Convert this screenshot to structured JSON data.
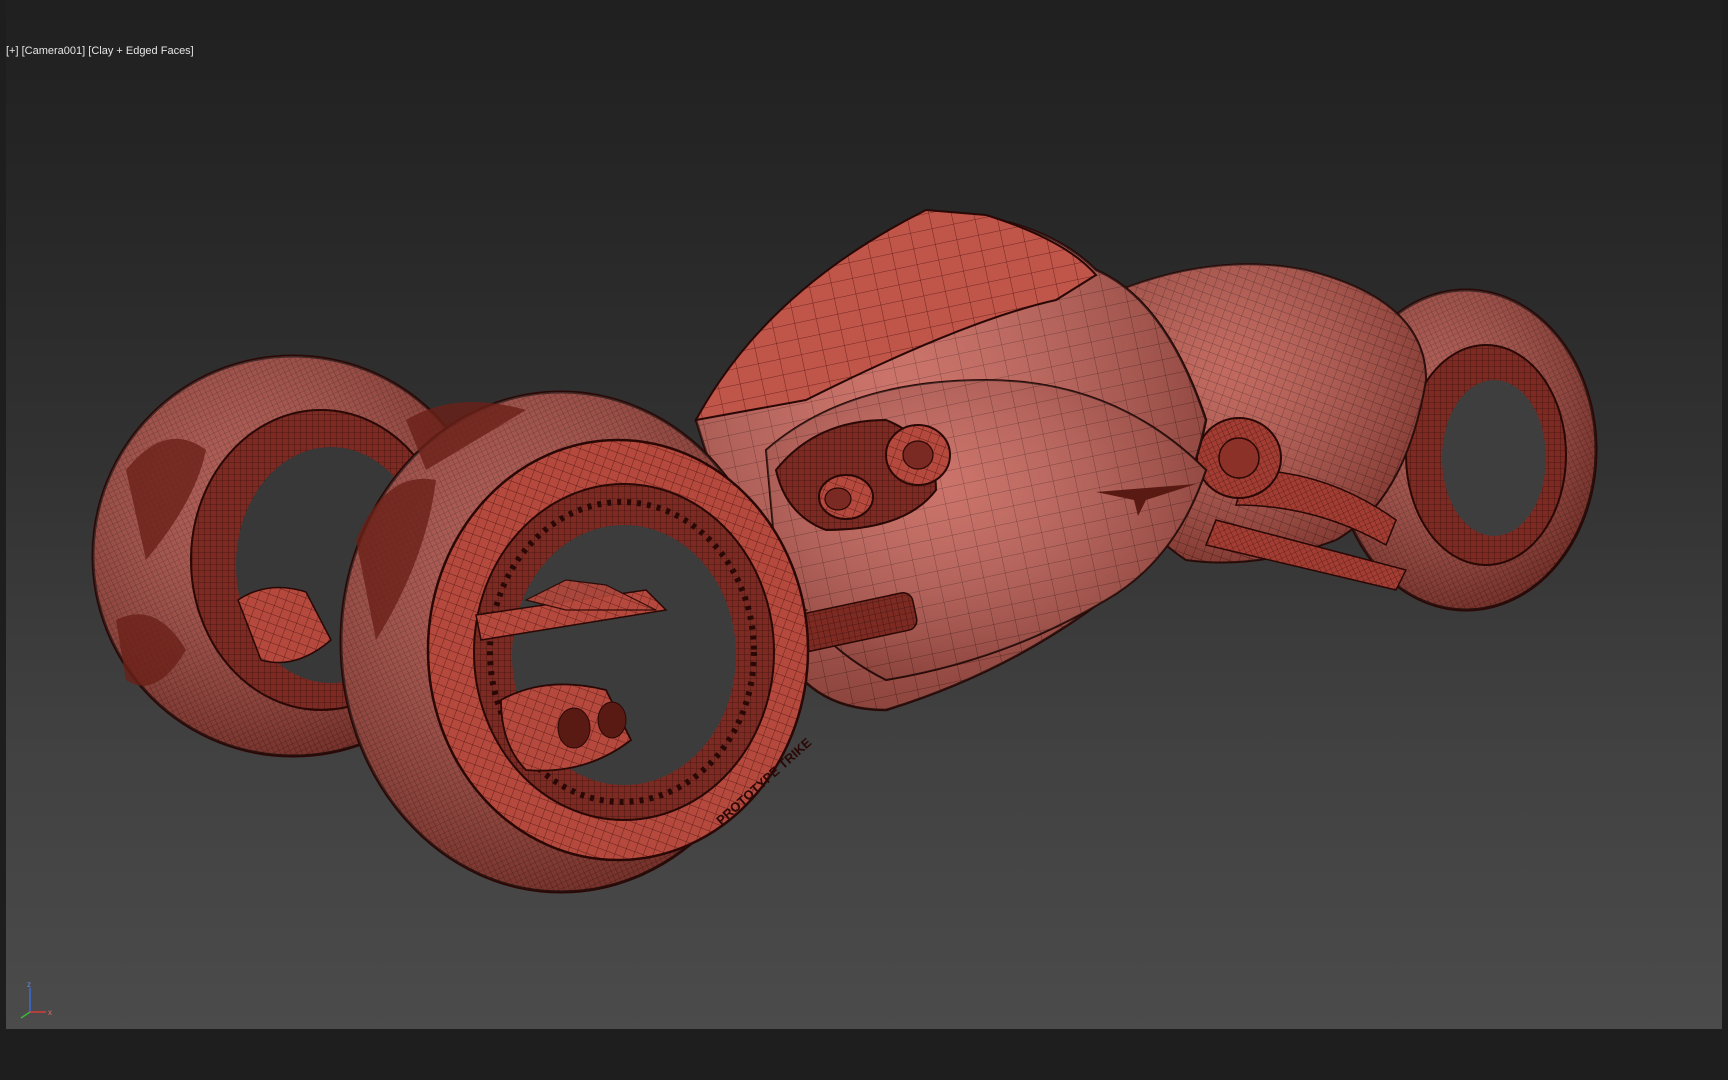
{
  "viewport": {
    "plus_menu": "[+]",
    "camera_menu": "[Camera001]",
    "shading_menu": "[Clay + Edged Faces]"
  },
  "axis_gizmo": {
    "z_label": "z",
    "x_label": "x",
    "colors": {
      "x": "#d83a3a",
      "y": "#3ab83a",
      "z": "#3a6ad8"
    }
  },
  "model": {
    "name": "futuristic-trike",
    "clay_color": "#b4483c",
    "wire_color": "#3a0f0a",
    "decal_text": "PROTOTYPE TRIKE"
  }
}
